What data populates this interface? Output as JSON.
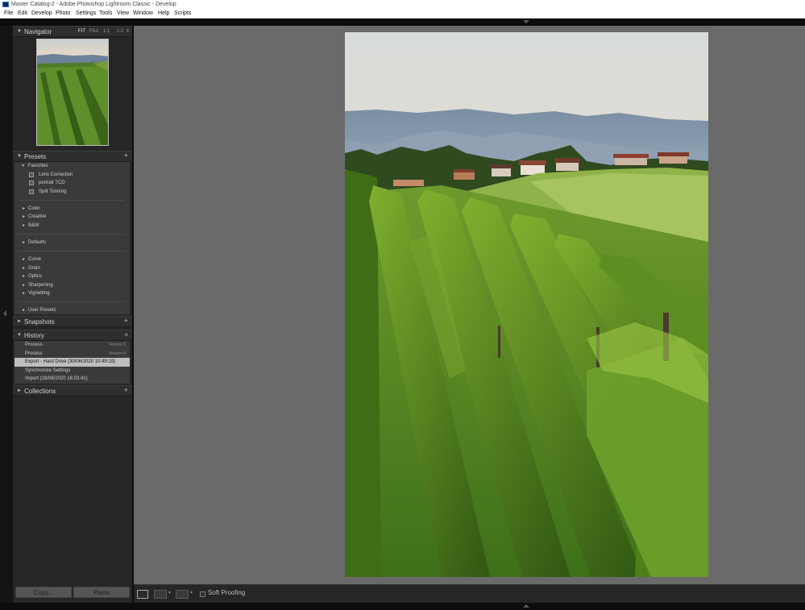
{
  "window": {
    "title": "Master Catalog-2 - Adobe Photoshop Lightroom Classic - Develop",
    "app_icon": "Lrc"
  },
  "menu": [
    "File",
    "Edit",
    "Develop",
    "Photo",
    "Settings",
    "Tools",
    "View",
    "Window",
    "Help",
    "Scripts"
  ],
  "navigator": {
    "title": "Navigator",
    "zoom": [
      "FIT",
      "FILL",
      "1:1",
      "1:2"
    ],
    "active_zoom": "FIT"
  },
  "presets": {
    "title": "Presets",
    "favorites": {
      "label": "Favorites",
      "items": [
        "Lens Correction",
        "portrait TCD",
        "Split Tonning"
      ]
    },
    "group1": [
      "Color",
      "Creative",
      "B&W"
    ],
    "group2": [
      "Defaults"
    ],
    "group3": [
      "Curve",
      "Grain",
      "Optics",
      "Sharpening",
      "Vignetting"
    ],
    "group4": [
      "User Presets"
    ]
  },
  "snapshots": {
    "title": "Snapshots"
  },
  "history": {
    "title": "History",
    "close": "×",
    "items": [
      {
        "label": "Process",
        "version": "Version 5"
      },
      {
        "label": "Process",
        "version": "Version 4"
      },
      {
        "label": "Export - Hard Drive (30/06/2020 10:49:19)",
        "version": ""
      },
      {
        "label": "Synchronize Settings",
        "version": ""
      },
      {
        "label": "Import (28/06/2020 16:03:41)",
        "version": ""
      }
    ],
    "selected_index": 2
  },
  "collections": {
    "title": "Collections"
  },
  "buttons": {
    "copy": "Copy...",
    "paste": "Paste"
  },
  "toolbar": {
    "soft_proofing": "Soft Proofing",
    "soft_proofing_checked": false
  },
  "icons": {
    "panel_expanded": "triangle-down-icon",
    "panel_collapsed": "triangle-right-icon",
    "add": "plus-icon",
    "close": "close-icon"
  },
  "colors": {
    "panel_bg": "#262626",
    "canvas_bg": "#6a6a6a",
    "selected_row": "#bebebe"
  }
}
